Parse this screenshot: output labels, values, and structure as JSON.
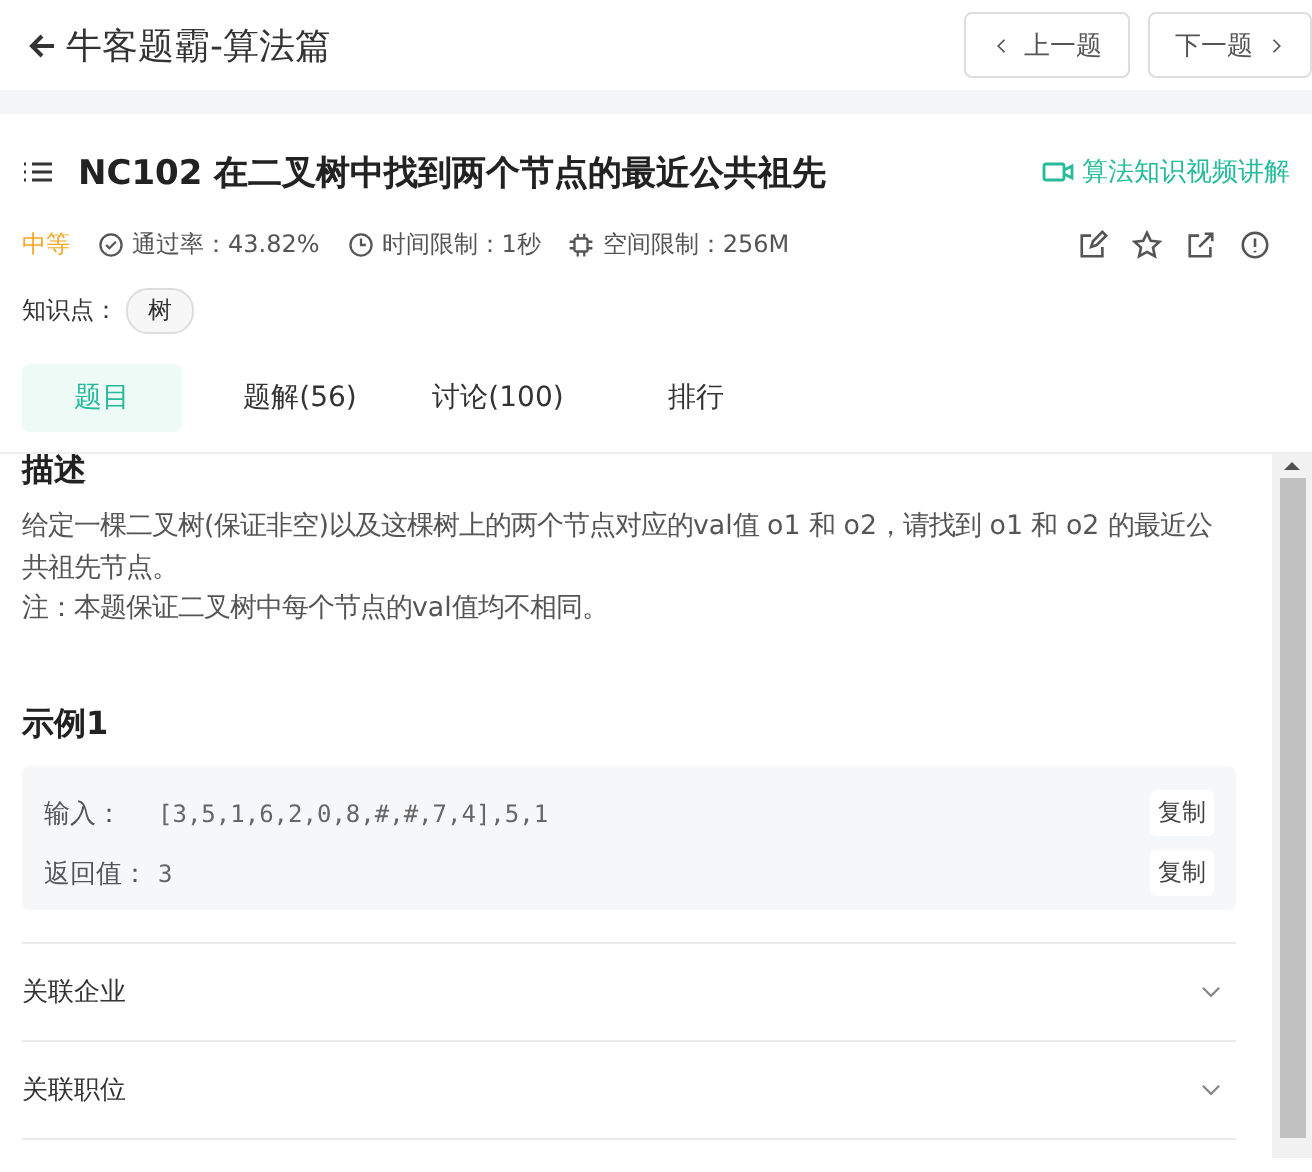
{
  "header": {
    "back_icon_label": "牛客题霸-算法篇",
    "prev_button": "上一题",
    "next_button": "下一题"
  },
  "problem": {
    "code": "NC102",
    "title": "在二叉树中找到两个节点的最近公共祖先",
    "video_link": "算法知识视频讲解",
    "difficulty": "中等",
    "pass_rate": "通过率：43.82%",
    "time_limit": "时间限制：1秒",
    "space_limit": "空间限制：256M"
  },
  "knowledge": {
    "label": "知识点：",
    "tags": [
      "树"
    ]
  },
  "tabs": [
    {
      "label": "题目",
      "selected": true
    },
    {
      "label": "题解(56)",
      "selected": false
    },
    {
      "label": "讨论(100)",
      "selected": false
    },
    {
      "label": "排行",
      "selected": false
    }
  ],
  "content": {
    "heading": "描述",
    "paragraphs": [
      "给定一棵二叉树(保证非空)以及这棵树上的两个节点对应的val值 o1 和 o2，请找到 o1 和 o2 的最近公共祖先节点。",
      "注：本题保证二叉树中每个节点的val值均不相同。"
    ],
    "example": {
      "title": "示例1",
      "rows": [
        {
          "label": "输入：",
          "value": "[3,5,1,6,2,0,8,#,#,7,4],5,1",
          "copy": "复制"
        },
        {
          "label": "返回值：",
          "value": "3",
          "copy": "复制"
        }
      ]
    },
    "sections": [
      {
        "label": "关联企业",
        "expanded": false
      },
      {
        "label": "关联职位",
        "expanded": false
      }
    ]
  }
}
